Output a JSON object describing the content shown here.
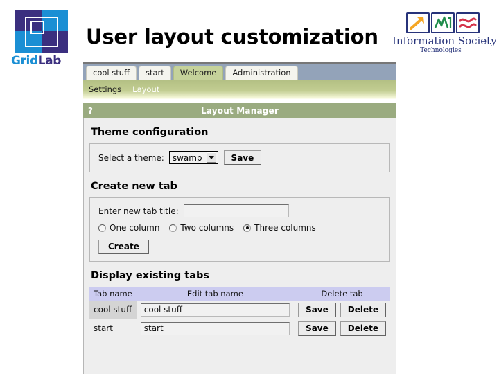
{
  "slide": {
    "title": "User layout customization"
  },
  "logos": {
    "gridlab": {
      "name": "GridLab",
      "word_part1": "Grid",
      "word_part2": "Lab",
      "colors": {
        "blue": "#1b8fd4",
        "purple": "#3b2f7f"
      }
    },
    "ist": {
      "caption_line1": "Information Society",
      "caption_line2": "Technologies",
      "icons": [
        "arrow-up-right-icon",
        "line-chart-icon",
        "wave-lines-icon"
      ],
      "colors": {
        "frame": "#27337a",
        "arrow": "#f5a623",
        "chart": "#1e8c4a",
        "wave": "#d4334a"
      }
    }
  },
  "portal": {
    "tabs": [
      {
        "label": "cool stuff",
        "active": false
      },
      {
        "label": "start",
        "active": false
      },
      {
        "label": "Welcome",
        "active": true
      },
      {
        "label": "Administration",
        "active": false
      }
    ],
    "subnav": [
      {
        "label": "Settings",
        "selected": true
      },
      {
        "label": "Layout",
        "selected": false
      }
    ],
    "portlet": {
      "help_glyph": "?",
      "title": "Layout Manager"
    },
    "theme_section": {
      "heading": "Theme configuration",
      "select_label": "Select a theme:",
      "selected_theme": "swamp",
      "theme_options": [
        "swamp"
      ],
      "save_label": "Save"
    },
    "create_section": {
      "heading": "Create new tab",
      "title_label": "Enter new tab title:",
      "title_value": "",
      "title_placeholder": "",
      "columns": [
        {
          "label": "One column",
          "checked": false
        },
        {
          "label": "Two columns",
          "checked": false
        },
        {
          "label": "Three columns",
          "checked": true
        }
      ],
      "create_label": "Create"
    },
    "display_section": {
      "heading": "Display existing tabs",
      "columns": [
        "Tab name",
        "Edit tab name",
        "Delete tab"
      ],
      "rows": [
        {
          "name": "cool stuff",
          "edit_value": "cool stuff",
          "save_label": "Save",
          "delete_label": "Delete"
        },
        {
          "name": "start",
          "edit_value": "start",
          "save_label": "Save",
          "delete_label": "Delete"
        }
      ]
    },
    "colors": {
      "tabstrip_bg": "#93a3b9",
      "tab_active_bg": "#c5d29a",
      "subnav_green": "#b3c084",
      "portlet_title_bg": "#9aab80",
      "table_header_bg": "#ccccf0",
      "panel_bg": "#eeeeee"
    }
  }
}
